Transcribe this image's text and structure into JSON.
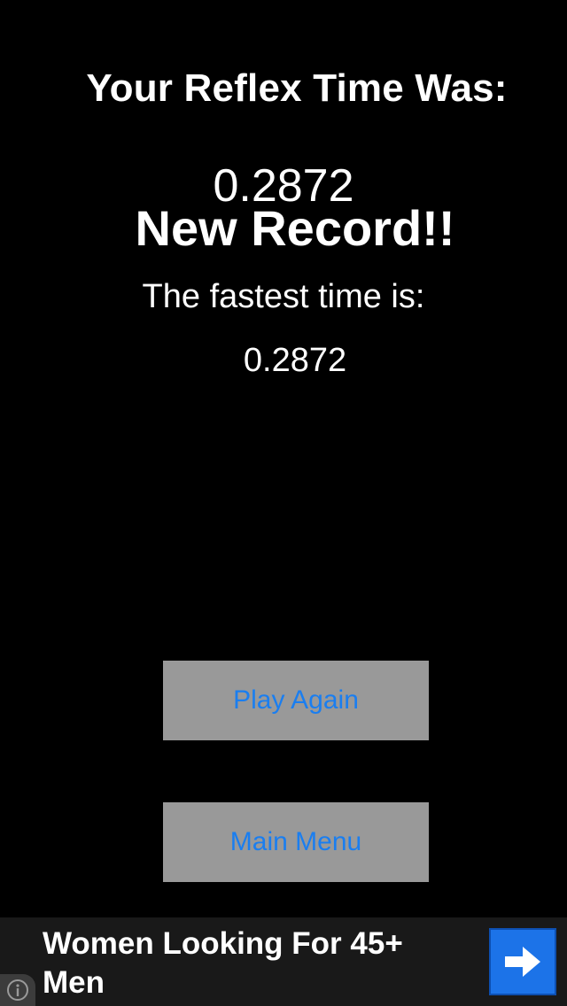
{
  "result": {
    "title": "Your Reflex Time Was:",
    "reflex_time": "0.2872",
    "new_record": "New Record!!",
    "fastest_label": "The fastest time is:",
    "fastest_value": "0.2872"
  },
  "buttons": {
    "play_again": "Play Again",
    "main_menu": "Main Menu"
  },
  "ad": {
    "text": "Women Looking For 45+ Men",
    "info_icon": "info-icon",
    "arrow_icon": "arrow-right-icon"
  },
  "colors": {
    "background": "#000000",
    "button_bg": "#999999",
    "button_text": "#1a7ef0",
    "ad_arrow_bg": "#1c73e8"
  }
}
